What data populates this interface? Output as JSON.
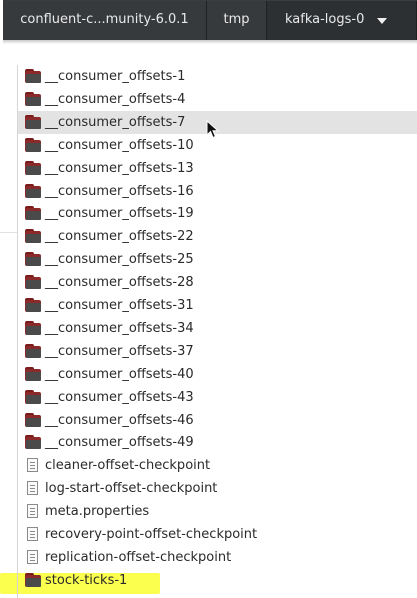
{
  "breadcrumbs": {
    "items": [
      "confluent-c...munity-6.0.1",
      "tmp",
      "kafka-logs-0"
    ]
  },
  "files": [
    {
      "name": "__consumer_offsets-1",
      "type": "folder"
    },
    {
      "name": "__consumer_offsets-4",
      "type": "folder"
    },
    {
      "name": "__consumer_offsets-7",
      "type": "folder",
      "selected": true
    },
    {
      "name": "__consumer_offsets-10",
      "type": "folder"
    },
    {
      "name": "__consumer_offsets-13",
      "type": "folder"
    },
    {
      "name": "__consumer_offsets-16",
      "type": "folder"
    },
    {
      "name": "__consumer_offsets-19",
      "type": "folder"
    },
    {
      "name": "__consumer_offsets-22",
      "type": "folder"
    },
    {
      "name": "__consumer_offsets-25",
      "type": "folder"
    },
    {
      "name": "__consumer_offsets-28",
      "type": "folder"
    },
    {
      "name": "__consumer_offsets-31",
      "type": "folder"
    },
    {
      "name": "__consumer_offsets-34",
      "type": "folder"
    },
    {
      "name": "__consumer_offsets-37",
      "type": "folder"
    },
    {
      "name": "__consumer_offsets-40",
      "type": "folder"
    },
    {
      "name": "__consumer_offsets-43",
      "type": "folder"
    },
    {
      "name": "__consumer_offsets-46",
      "type": "folder"
    },
    {
      "name": "__consumer_offsets-49",
      "type": "folder"
    },
    {
      "name": "cleaner-offset-checkpoint",
      "type": "file"
    },
    {
      "name": "log-start-offset-checkpoint",
      "type": "file"
    },
    {
      "name": "meta.properties",
      "type": "file"
    },
    {
      "name": "recovery-point-offset-checkpoint",
      "type": "file"
    },
    {
      "name": "replication-offset-checkpoint",
      "type": "file"
    },
    {
      "name": "stock-ticks-1",
      "type": "folder",
      "highlighted": true
    }
  ],
  "colors": {
    "pathbar_bg": "#2f3234",
    "folder": "#8b2a2a",
    "selection": "#e3e3e3",
    "highlight": "#fbff3a"
  }
}
